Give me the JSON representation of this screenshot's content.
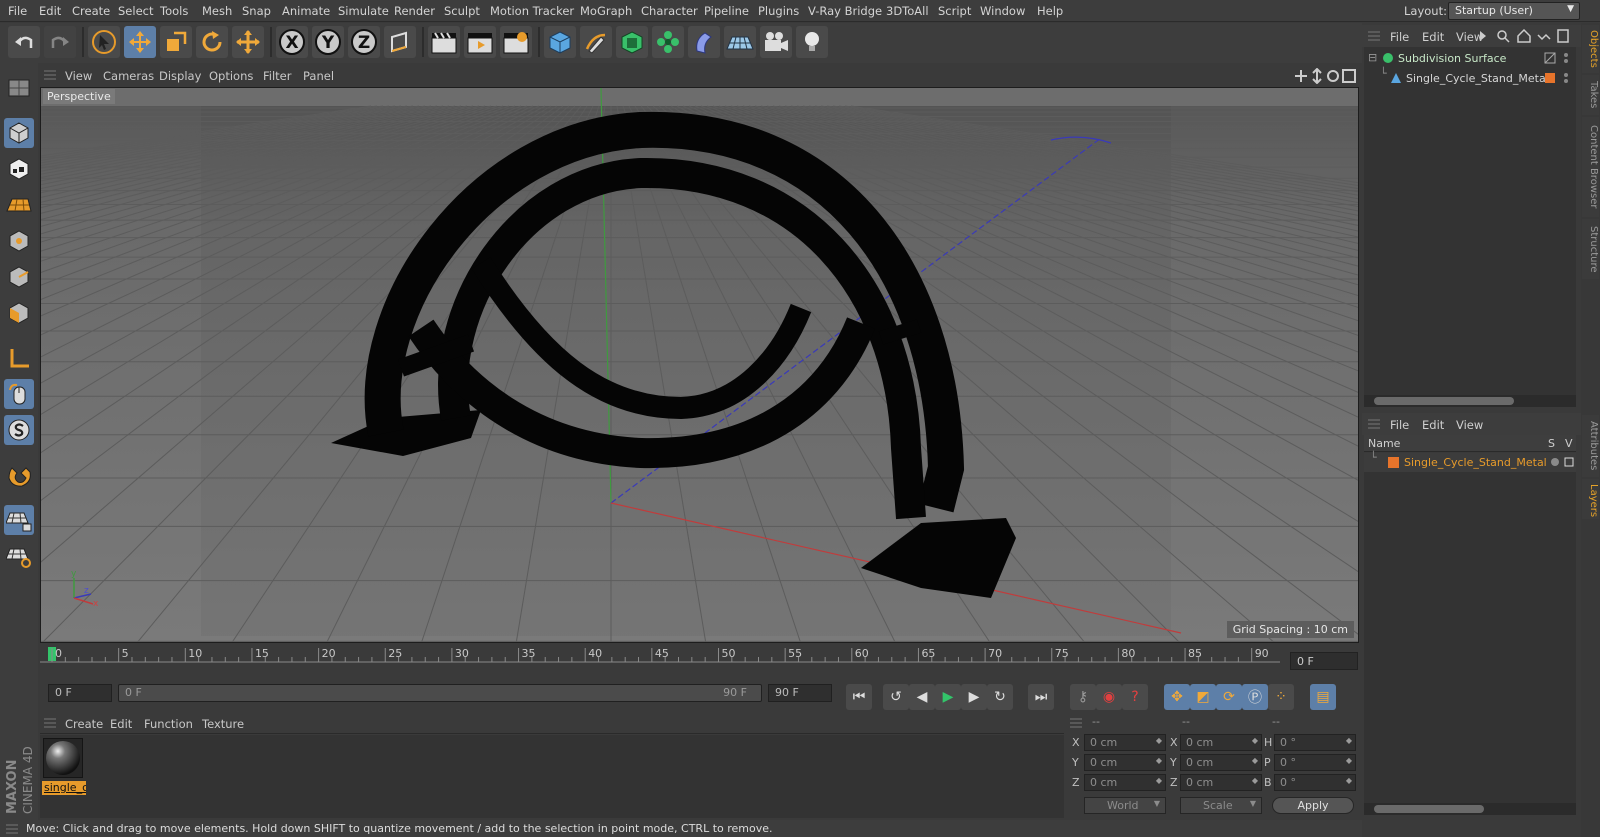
{
  "menubar": {
    "items": [
      "File",
      "Edit",
      "Create",
      "Select",
      "Tools",
      "Mesh",
      "Snap",
      "Animate",
      "Simulate",
      "Render",
      "Sculpt",
      "Motion Tracker",
      "MoGraph",
      "Character",
      "Pipeline",
      "Plugins",
      "V-Ray Bridge",
      "3DToAll",
      "Script",
      "Window",
      "Help"
    ],
    "layout_label": "Layout:",
    "layout_value": "Startup (User)"
  },
  "toolbar": {
    "axis_x": "X",
    "axis_y": "Y",
    "axis_z": "Z"
  },
  "viewport": {
    "menu": [
      "View",
      "Cameras",
      "Display",
      "Options",
      "Filter",
      "Panel"
    ],
    "camera_label": "Perspective",
    "grid_spacing": "Grid Spacing : 10 cm",
    "axis_y": "y",
    "axis_z": "z",
    "axis_x": "x"
  },
  "timeline": {
    "ticks": [
      "0",
      "5",
      "10",
      "15",
      "20",
      "25",
      "30",
      "35",
      "40",
      "45",
      "50",
      "55",
      "60",
      "65",
      "70",
      "75",
      "80",
      "85",
      "90"
    ],
    "current_frame": "0 F",
    "start_field": "0 F",
    "range_start": "0 F",
    "range_end": "90 F",
    "end_field": "90 F"
  },
  "material_manager": {
    "menu": [
      "Create",
      "Edit",
      "Function",
      "Texture"
    ],
    "material_name": "single_c"
  },
  "coordinates": {
    "header_cols": [
      "--",
      "--",
      "--"
    ],
    "rows": [
      {
        "l1": "X",
        "v1": "0 cm",
        "l2": "X",
        "v2": "0 cm",
        "l3": "H",
        "v3": "0 °"
      },
      {
        "l1": "Y",
        "v1": "0 cm",
        "l2": "Y",
        "v2": "0 cm",
        "l3": "P",
        "v3": "0 °"
      },
      {
        "l1": "Z",
        "v1": "0 cm",
        "l2": "Z",
        "v2": "0 cm",
        "l3": "B",
        "v3": "0 °"
      }
    ],
    "space": "World",
    "mode": "Scale",
    "apply": "Apply"
  },
  "status": "Move: Click and drag to move elements. Hold down SHIFT to quantize movement / add to the selection in point mode, CTRL to remove.",
  "objects_panel": {
    "menu": [
      "File",
      "Edit",
      "View"
    ],
    "items": [
      {
        "name": "Subdivision Surface"
      },
      {
        "name": "Single_Cycle_Stand_Metal"
      }
    ]
  },
  "layers_panel": {
    "menu": [
      "File",
      "Edit",
      "View"
    ],
    "col_name": "Name",
    "col_s": "S",
    "col_v": "V",
    "items": [
      {
        "name": "Single_Cycle_Stand_Metal"
      }
    ]
  },
  "side_tabs": [
    "Objects",
    "Takes",
    "Content Browser",
    "Structure",
    "Attributes",
    "Layers"
  ],
  "logo": {
    "line1": "MAXON",
    "line2": "CINEMA 4D"
  },
  "colors": {
    "accent_orange": "#e79b2b",
    "selection_blue": "#5d7fa8",
    "viewport_bg": "#6b6b6b"
  }
}
